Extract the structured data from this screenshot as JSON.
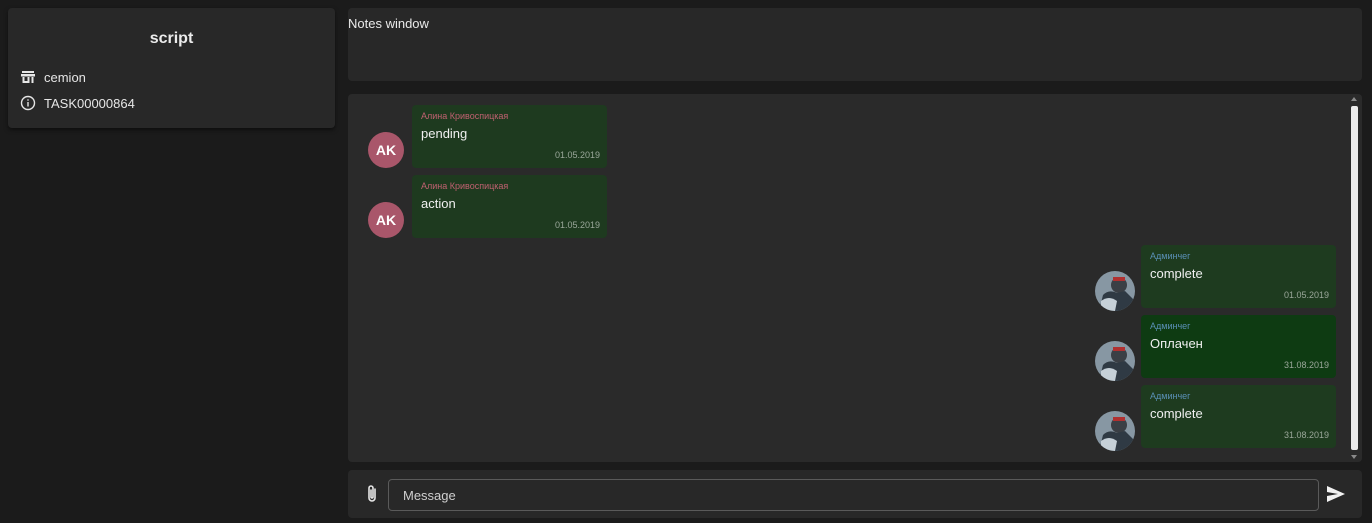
{
  "sidebar": {
    "title": "script",
    "items": [
      {
        "icon": "store-icon",
        "label": "cemion"
      },
      {
        "icon": "info-icon",
        "label": "TASK00000864"
      }
    ]
  },
  "notes": {
    "title": "Notes window"
  },
  "chat": {
    "messages": [
      {
        "direction": "in",
        "author": "Алина Кривоспицкая",
        "initials": "AK",
        "text": "pending",
        "date": "01.05.2019"
      },
      {
        "direction": "in",
        "author": "Алина Кривоспицкая",
        "initials": "AK",
        "text": "action",
        "date": "01.05.2019"
      },
      {
        "direction": "out",
        "author": "Админчег",
        "text": "complete",
        "date": "01.05.2019"
      },
      {
        "direction": "out",
        "author": "Админчег",
        "text": "Оплачен",
        "date": "31.08.2019"
      },
      {
        "direction": "out",
        "author": "Админчег",
        "text": "complete",
        "date": "31.08.2019"
      }
    ]
  },
  "composer": {
    "placeholder": "Message"
  },
  "colors": {
    "background": "#1b1b1b",
    "panel": "#282828",
    "bubble": "#1e3a1f",
    "avatar": "#a9566a",
    "incoming_author": "#c06070",
    "outgoing_author": "#5a8fb6"
  }
}
